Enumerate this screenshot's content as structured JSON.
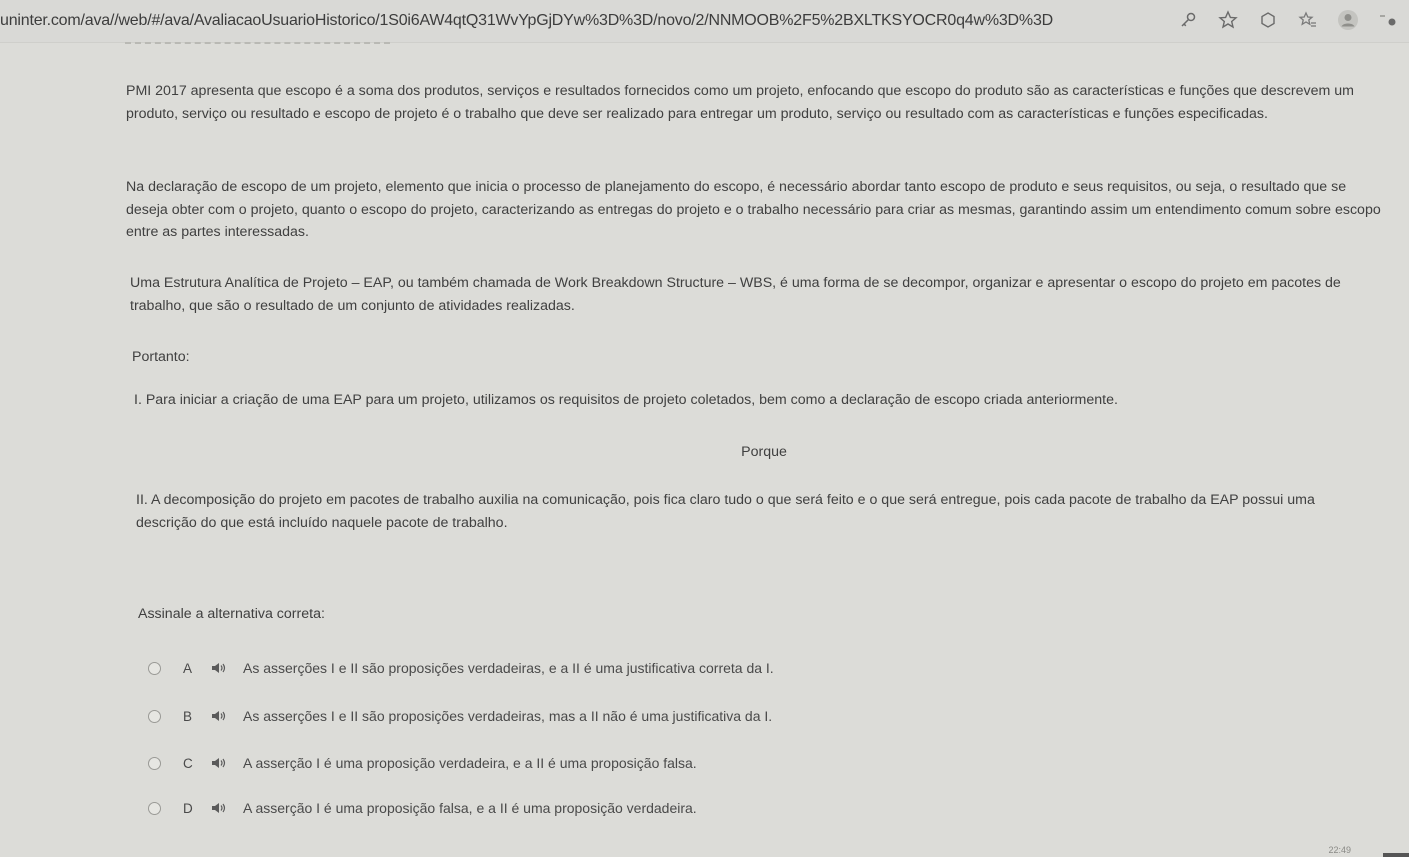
{
  "browser": {
    "url": "uninter.com/ava//web/#/ava/AvaliacaoUsuarioHistorico/1S0i6AW4qtQ31WvYpGjDYw%3D%3D/novo/2/NNMOOB%2F5%2BXLTKSYOCR0q4w%3D%3D",
    "icons": [
      "key-icon",
      "star-icon",
      "extension-icon",
      "favorites-icon",
      "profile-icon",
      "menu-icon"
    ]
  },
  "question": {
    "paragraphs": [
      "PMI 2017 apresenta que escopo é a soma dos produtos, serviços e resultados fornecidos como um projeto, enfocando que escopo do produto são as características e funções que descrevem um produto, serviço ou resultado e escopo de projeto é o trabalho que deve ser realizado para entregar um produto, serviço ou resultado com as características e funções especificadas.",
      "Na declaração de escopo de um projeto, elemento que inicia o processo de planejamento do escopo, é necessário abordar tanto escopo de produto e seus requisitos, ou seja, o resultado que se deseja obter com o projeto, quanto o escopo do projeto, caracterizando as entregas do projeto e o trabalho necessário para criar as mesmas, garantindo assim um entendimento comum sobre escopo entre as partes interessadas.",
      "Uma Estrutura Analítica de Projeto – EAP, ou também chamada de Work Breakdown Structure – WBS, é uma forma de se decompor, organizar e apresentar o escopo do projeto em pacotes de trabalho, que são o resultado de um conjunto de atividades realizadas."
    ],
    "portanto": "Portanto:",
    "assertion_1": "I. Para iniciar a criação de uma EAP para um projeto, utilizamos os requisitos de projeto coletados, bem como a declaração de escopo criada anteriormente.",
    "porque": "Porque",
    "assertion_2": "II. A decomposição do projeto em pacotes de trabalho auxilia na comunicação, pois fica claro tudo o que será feito e o que será entregue, pois cada pacote de trabalho da EAP possui uma descrição do que está incluído naquele pacote de trabalho.",
    "prompt": "Assinale a alternativa correta:"
  },
  "options": [
    {
      "letter": "A",
      "text": "As asserções I e II são proposições verdadeiras, e a II é uma justificativa correta da I."
    },
    {
      "letter": "B",
      "text": "As asserções I e II são proposições verdadeiras, mas a II não é uma justificativa da I."
    },
    {
      "letter": "C",
      "text": "A asserção I é uma proposição verdadeira, e a II é uma proposição falsa."
    },
    {
      "letter": "D",
      "text": "A asserção I é uma proposição falsa, e a II é uma proposição verdadeira."
    }
  ],
  "status": {
    "clock": "22:49"
  }
}
